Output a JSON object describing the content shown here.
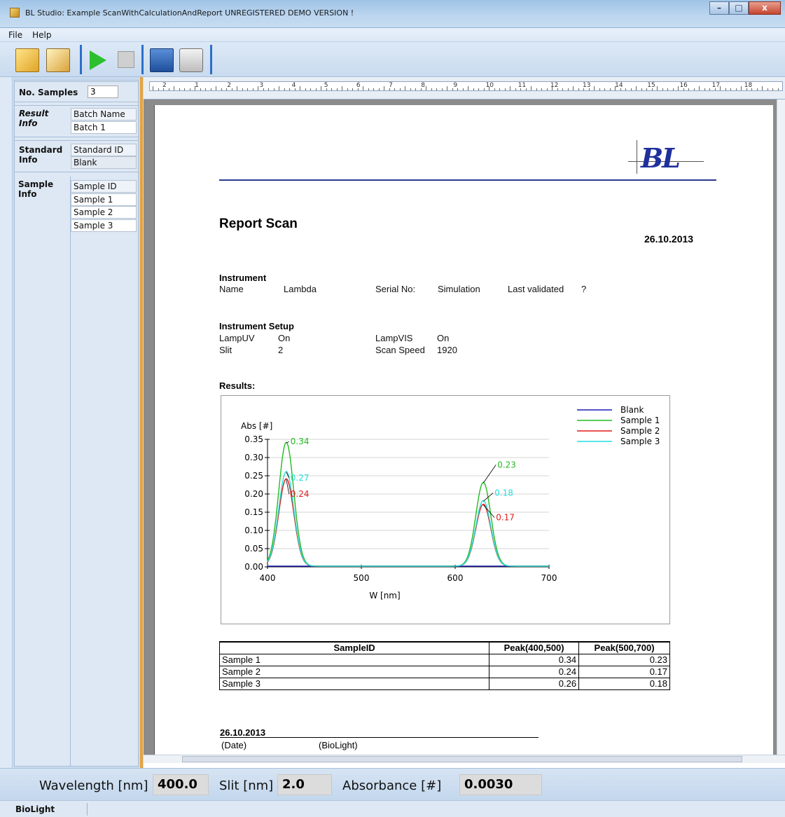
{
  "window": {
    "title": "BL Studio: Example ScanWithCalculationAndReport  UNREGISTERED DEMO VERSION !"
  },
  "menu": {
    "items": [
      "File",
      "Help"
    ]
  },
  "toolbar": {
    "icons": [
      "open-folder-icon",
      "clipboard-icon",
      "play-icon",
      "stop-icon",
      "save-icon",
      "print-icon"
    ]
  },
  "left_panel": {
    "no_samples_label": "No. Samples",
    "no_samples_value": "3",
    "result_info_label": "Result Info",
    "result_info_fields": [
      "Batch Name",
      "Batch 1"
    ],
    "standard_info_label": "Standard Info",
    "standard_info_fields": [
      "Standard ID",
      "Blank"
    ],
    "sample_info_label": "Sample Info",
    "sample_info_fields": [
      "Sample ID",
      "Sample 1",
      "Sample 2",
      "Sample 3"
    ]
  },
  "report": {
    "logo_text": "BL",
    "title": "Report Scan",
    "date": "26.10.2013",
    "instrument": {
      "heading": "Instrument",
      "name_label": "Name",
      "name_value": "Lambda",
      "serial_label": "Serial No:",
      "serial_value": "Simulation",
      "validated_label": "Last validated",
      "validated_value": "?"
    },
    "setup": {
      "heading": "Instrument Setup",
      "lamp_uv_label": "LampUV",
      "lamp_uv_value": "On",
      "lamp_vis_label": "LampVIS",
      "lamp_vis_value": "On",
      "slit_label": "Slit",
      "slit_value": "2",
      "speed_label": "Scan Speed",
      "speed_value": "1920"
    },
    "results_heading": "Results:",
    "table": {
      "headers": [
        "SampleID",
        "Peak(400,500)",
        "Peak(500,700)"
      ],
      "rows": [
        [
          "Sample 1",
          "0.34",
          "0.23"
        ],
        [
          "Sample 2",
          "0.24",
          "0.17"
        ],
        [
          "Sample 3",
          "0.26",
          "0.18"
        ]
      ]
    },
    "signature": {
      "date": "26.10.2013",
      "date_caption": "(Date)",
      "org_caption": "(BioLight)"
    }
  },
  "chart_data": {
    "type": "line",
    "title": "",
    "xlabel": "W [nm]",
    "ylabel": "Abs [#]",
    "xlim": [
      400,
      700
    ],
    "ylim": [
      0,
      0.35
    ],
    "xticks": [
      "400",
      "500",
      "600",
      "700"
    ],
    "yticks": [
      "0.00",
      "0.05",
      "0.10",
      "0.15",
      "0.20",
      "0.25",
      "0.30",
      "0.35"
    ],
    "grid": true,
    "legend_position": "top-right",
    "series": [
      {
        "name": "Blank",
        "color": "#1c1cb8",
        "peaks": []
      },
      {
        "name": "Sample 1",
        "color": "#22bb22",
        "peaks": [
          {
            "x": 420,
            "y": 0.34
          },
          {
            "x": 630,
            "y": 0.23
          }
        ]
      },
      {
        "name": "Sample 2",
        "color": "#e21b1b",
        "peaks": [
          {
            "x": 420,
            "y": 0.24
          },
          {
            "x": 630,
            "y": 0.17
          }
        ]
      },
      {
        "name": "Sample 3",
        "color": "#22dede",
        "peaks": [
          {
            "x": 420,
            "y": 0.26
          },
          {
            "x": 630,
            "y": 0.18
          }
        ]
      }
    ],
    "annotations": [
      {
        "series": "Sample 1",
        "x": 420,
        "y": 0.34,
        "text": "0.34"
      },
      {
        "series": "Sample 3",
        "x": 420,
        "y": 0.26,
        "text": "0.27"
      },
      {
        "series": "Sample 2",
        "x": 420,
        "y": 0.24,
        "text": "0.24"
      },
      {
        "series": "Sample 1",
        "x": 630,
        "y": 0.23,
        "text": "0.23"
      },
      {
        "series": "Sample 3",
        "x": 630,
        "y": 0.18,
        "text": "0.18"
      },
      {
        "series": "Sample 2",
        "x": 630,
        "y": 0.17,
        "text": "0.17"
      }
    ]
  },
  "readout": {
    "wavelength_label": "Wavelength [nm]",
    "wavelength_value": "400.0",
    "slit_label": "Slit [nm]",
    "slit_value": "2.0",
    "absorbance_label": "Absorbance [#]",
    "absorbance_value": "0.0030"
  },
  "status": {
    "text": "BioLight"
  },
  "ruler": {
    "numbers": [
      "2",
      "1",
      "2",
      "3",
      "4",
      "5",
      "6",
      "7",
      "8",
      "9",
      "10",
      "11",
      "12",
      "13",
      "14",
      "15",
      "16",
      "17",
      "18"
    ]
  }
}
